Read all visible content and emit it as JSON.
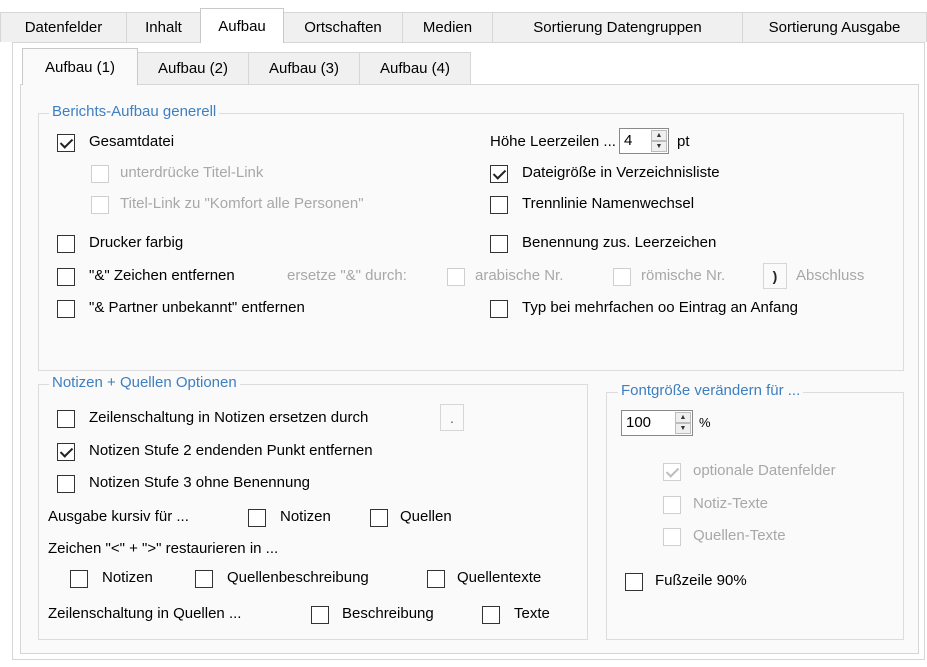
{
  "tabs": [
    "Datenfelder",
    "Inhalt",
    "Aufbau",
    "Ortschaften",
    "Medien",
    "Sortierung Datengruppen",
    "Sortierung Ausgabe"
  ],
  "subtabs": [
    "Aufbau (1)",
    "Aufbau (2)",
    "Aufbau (3)",
    "Aufbau (4)"
  ],
  "general": {
    "legend": "Berichts-Aufbau generell",
    "gesamtdatei": "Gesamtdatei",
    "unterdruecke": "unterdrücke Titel-Link",
    "titel_link": "Titel-Link zu \"Komfort alle Personen\"",
    "drucker": "Drucker farbig",
    "zeichen_entfernen": "\"&\" Zeichen entfernen",
    "ersetze": "ersetze \"&\" durch:",
    "arabische": "arabische Nr.",
    "roemische": "römische Nr.",
    "abschluss_char": ")",
    "abschluss": "Abschluss",
    "partner": "\"& Partner unbekannt\" entfernen",
    "hoehe_label": "Höhe Leerzeilen ...",
    "hoehe_value": "4",
    "hoehe_unit": "pt",
    "dateigroesse": "Dateigröße in Verzeichnisliste",
    "trennlinie": "Trennlinie Namenwechsel",
    "benennung": "Benennung zus. Leerzeichen",
    "typ": "Typ bei mehrfachen oo Eintrag an Anfang"
  },
  "notes": {
    "legend": "Notizen + Quellen Optionen",
    "zeilenschaltung": "Zeilenschaltung in Notizen ersetzen durch",
    "zeilen_char": ".",
    "stufe2": "Notizen Stufe 2 endenden Punkt entfernen",
    "stufe3": "Notizen Stufe 3 ohne Benennung",
    "kursiv_label": "Ausgabe kursiv für ...",
    "kursiv_notizen": "Notizen",
    "kursiv_quellen": "Quellen",
    "restaurieren_label": "Zeichen \"<\" + \">\" restaurieren in ...",
    "r_notizen": "Notizen",
    "r_quellenbeschreibung": "Quellenbeschreibung",
    "r_quellentexte": "Quellentexte",
    "zq_label": "Zeilenschaltung in Quellen ...",
    "zq_beschreibung": "Beschreibung",
    "zq_texte": "Texte"
  },
  "font": {
    "legend": "Fontgröße verändern für ...",
    "value": "100",
    "unit": "%",
    "optionale": "optionale Datenfelder",
    "notiz": "Notiz-Texte",
    "quellen": "Quellen-Texte",
    "fusszeile": "Fußzeile 90%"
  }
}
